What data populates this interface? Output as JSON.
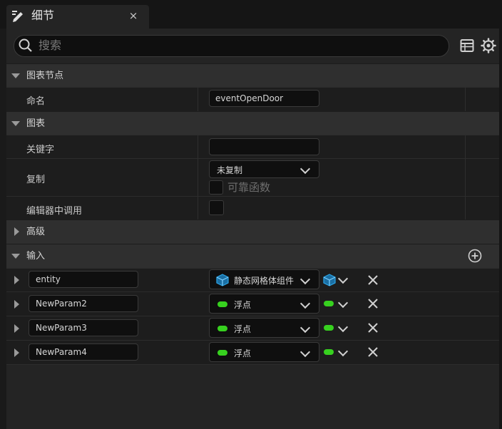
{
  "tab": {
    "title": "细节",
    "close": "×"
  },
  "search": {
    "placeholder": "搜索"
  },
  "sections": {
    "graph_node": "图表节点",
    "graph": "图表",
    "advanced": "高级",
    "inputs": "输入"
  },
  "rows": {
    "name_label": "命名",
    "name_value": "eventOpenDoor",
    "keyword_label": "关键字",
    "keyword_value": "",
    "replicate_label": "复制",
    "replicate_value": "未复制",
    "reliable_label": "可靠函数",
    "call_in_editor_label": "编辑器中调用"
  },
  "inputs": [
    {
      "name": "entity",
      "type": "静态网格体组件",
      "type_icon": "cube-icon",
      "color": "#2aa5e8"
    },
    {
      "name": "NewParam2",
      "type": "浮点",
      "type_icon": "pill-icon",
      "color": "#37d11f"
    },
    {
      "name": "NewParam3",
      "type": "浮点",
      "type_icon": "pill-icon",
      "color": "#37d11f"
    },
    {
      "name": "NewParam4",
      "type": "浮点",
      "type_icon": "pill-icon",
      "color": "#37d11f"
    }
  ],
  "colors": {
    "accent_float": "#37d11f",
    "accent_object": "#2aa5e8"
  }
}
